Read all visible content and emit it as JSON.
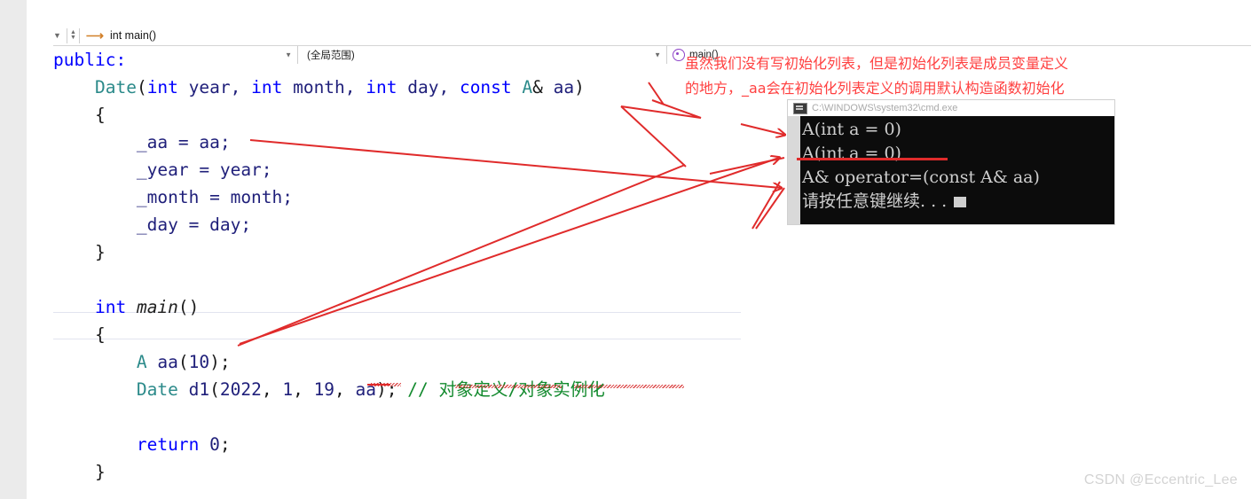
{
  "nav": {
    "caret_icon": "chevron-down-icon",
    "stepper_icon": "stepper-updown-icon",
    "goto_icon": "arrow-right-icon",
    "label": "int main()"
  },
  "scope_bar": {
    "project_value": "",
    "project_placeholder": "",
    "scope_value": "(全局范围)",
    "member_value": "main()",
    "member_icon": "method-icon",
    "dropdown_icon": "chevron-down-icon"
  },
  "editor": {
    "lines": [
      {
        "id": "l-public",
        "tokens": [
          {
            "t": "public:",
            "c": "kw"
          }
        ]
      },
      {
        "id": "l-ctor",
        "tokens": [
          {
            "t": "    ",
            "c": "punc"
          },
          {
            "t": "Date",
            "c": "type"
          },
          {
            "t": "(",
            "c": "punc"
          },
          {
            "t": "int",
            "c": "kw"
          },
          {
            "t": " year, ",
            "c": "ident"
          },
          {
            "t": "int",
            "c": "kw"
          },
          {
            "t": " month, ",
            "c": "ident"
          },
          {
            "t": "int",
            "c": "kw"
          },
          {
            "t": " day, ",
            "c": "ident"
          },
          {
            "t": "const",
            "c": "kw"
          },
          {
            "t": " ",
            "c": "punc"
          },
          {
            "t": "A",
            "c": "type"
          },
          {
            "t": "& ",
            "c": "punc"
          },
          {
            "t": "aa",
            "c": "ident"
          },
          {
            "t": ")",
            "c": "punc"
          }
        ]
      },
      {
        "id": "l-ob1",
        "tokens": [
          {
            "t": "    {",
            "c": "punc"
          }
        ]
      },
      {
        "id": "l-aa",
        "tokens": [
          {
            "t": "        _aa = aa;",
            "c": "ident"
          }
        ]
      },
      {
        "id": "l-year",
        "tokens": [
          {
            "t": "        _year = year;",
            "c": "ident"
          }
        ]
      },
      {
        "id": "l-month",
        "tokens": [
          {
            "t": "        _month = month;",
            "c": "ident"
          }
        ]
      },
      {
        "id": "l-day",
        "tokens": [
          {
            "t": "        _day = day;",
            "c": "ident"
          }
        ]
      },
      {
        "id": "l-cb1",
        "tokens": [
          {
            "t": "    }",
            "c": "punc"
          }
        ]
      },
      {
        "id": "l-blank1",
        "tokens": [
          {
            "t": " ",
            "c": "punc"
          }
        ]
      },
      {
        "id": "l-main",
        "tokens": [
          {
            "t": "    ",
            "c": "punc"
          },
          {
            "t": "int",
            "c": "kw"
          },
          {
            "t": " ",
            "c": "punc"
          },
          {
            "t": "main",
            "c": "fn"
          },
          {
            "t": "()",
            "c": "punc"
          }
        ]
      },
      {
        "id": "l-ob2",
        "tokens": [
          {
            "t": "    {",
            "c": "punc"
          }
        ]
      },
      {
        "id": "l-decl-a",
        "tokens": [
          {
            "t": "        ",
            "c": "punc"
          },
          {
            "t": "A",
            "c": "type"
          },
          {
            "t": " ",
            "c": "punc"
          },
          {
            "t": "aa",
            "c": "ident"
          },
          {
            "t": "(",
            "c": "punc"
          },
          {
            "t": "10",
            "c": "num"
          },
          {
            "t": ");",
            "c": "punc"
          }
        ]
      },
      {
        "id": "l-decl-d1",
        "tokens": [
          {
            "t": "        ",
            "c": "punc"
          },
          {
            "t": "Date",
            "c": "type"
          },
          {
            "t": " ",
            "c": "punc"
          },
          {
            "t": "d1",
            "c": "ident"
          },
          {
            "t": "(",
            "c": "punc"
          },
          {
            "t": "2022",
            "c": "num"
          },
          {
            "t": ", ",
            "c": "punc"
          },
          {
            "t": "1",
            "c": "num"
          },
          {
            "t": ", ",
            "c": "punc"
          },
          {
            "t": "19",
            "c": "num"
          },
          {
            "t": ", ",
            "c": "punc"
          },
          {
            "t": "aa",
            "c": "ident"
          },
          {
            "t": "); ",
            "c": "punc"
          },
          {
            "t": "// 对象定义/对象实例化",
            "c": "cmt"
          }
        ]
      },
      {
        "id": "l-blank2",
        "tokens": [
          {
            "t": " ",
            "c": "punc"
          }
        ]
      },
      {
        "id": "l-return",
        "tokens": [
          {
            "t": "        ",
            "c": "punc"
          },
          {
            "t": "return",
            "c": "kw"
          },
          {
            "t": " ",
            "c": "punc"
          },
          {
            "t": "0",
            "c": "num"
          },
          {
            "t": ";",
            "c": "punc"
          }
        ]
      },
      {
        "id": "l-cb2",
        "tokens": [
          {
            "t": "    }",
            "c": "punc"
          }
        ]
      }
    ]
  },
  "annotation": {
    "line1": "虽然我们没有写初始化列表，但是初始化列表是成员变量定义",
    "line2": "的地方，_aa会在初始化列表定义的调用默认构造函数初始化",
    "ink_color": "#ff4040"
  },
  "console": {
    "title": "C:\\WINDOWS\\system32\\cmd.exe",
    "title_icon": "console-window-icon",
    "lines": [
      "A(int a = 0)",
      "A(int a = 0)",
      "A& operator=(const A& aa)",
      "请按任意键继续. . ."
    ],
    "bg_color": "#0c0c0c",
    "fg_color": "#cfcfcf"
  },
  "watermark": {
    "text": "CSDN @Eccentric_Lee"
  }
}
